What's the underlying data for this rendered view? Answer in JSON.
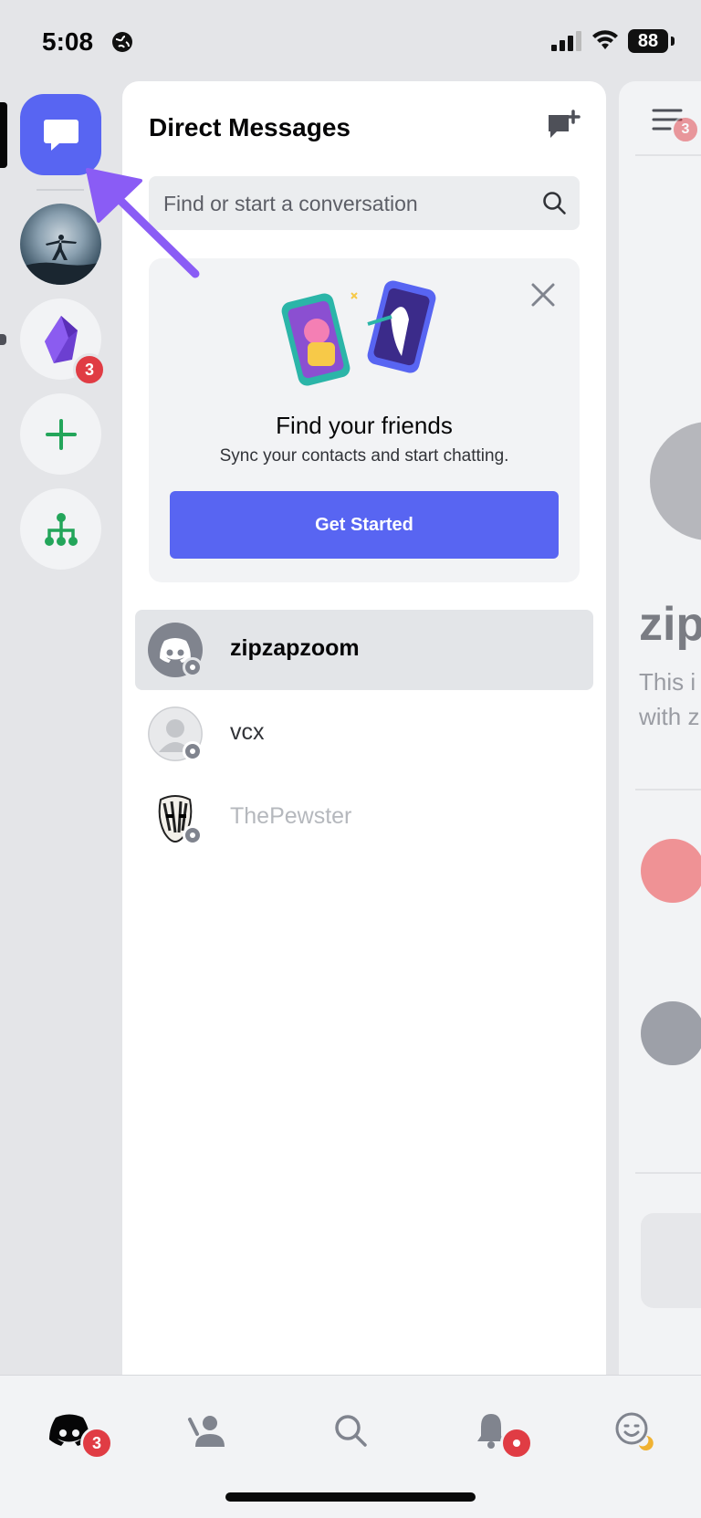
{
  "status_bar": {
    "time": "5:08",
    "battery": "88"
  },
  "header": {
    "title": "Direct Messages"
  },
  "search": {
    "placeholder": "Find or start a conversation"
  },
  "friends_card": {
    "title": "Find your friends",
    "subtitle": "Sync your contacts and start chatting.",
    "button_label": "Get Started"
  },
  "servers": [
    {
      "name": "moon-server"
    },
    {
      "name": "crystal-server",
      "badge": "3"
    }
  ],
  "dm_list": [
    {
      "name": "zipzapzoom",
      "active": true
    },
    {
      "name": "vcx",
      "active": false
    },
    {
      "name": "ThePewster",
      "active": false
    }
  ],
  "peek": {
    "heading": "zip",
    "line1": "This i",
    "line2": "with z",
    "badge": "3"
  },
  "tabbar": {
    "home_badge": "3"
  },
  "colors": {
    "blurple": "#5865f2",
    "red": "#e03c44",
    "green": "#23a55a"
  }
}
